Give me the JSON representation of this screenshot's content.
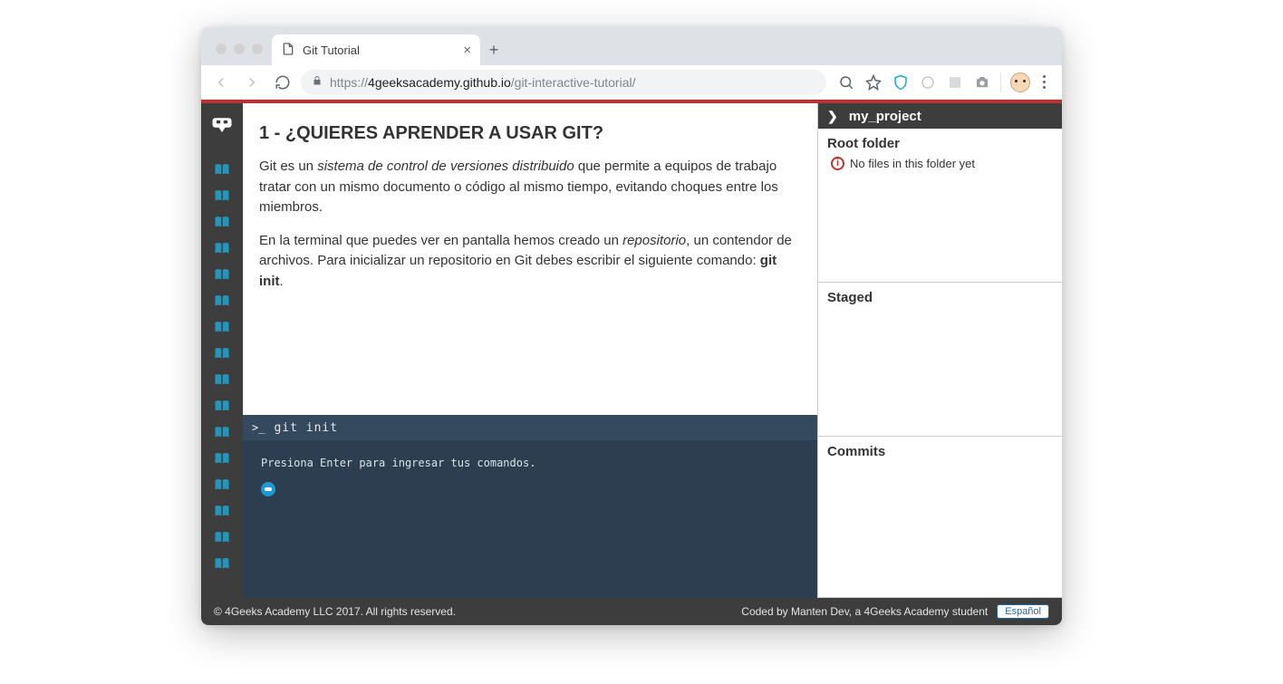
{
  "browser": {
    "tab_title": "Git Tutorial",
    "url_prefix": "https://",
    "url_host": "4geeksacademy.github.io",
    "url_path": "/git-interactive-tutorial/"
  },
  "sidebar": {
    "lesson_count": 16
  },
  "lesson": {
    "heading": "1 - ¿QUIERES APRENDER A USAR GIT?",
    "p1_a": "Git es un ",
    "p1_em": "sistema de control de versiones distribuido",
    "p1_b": " que permite a equipos de trabajo tratar con un mismo documento o código al mismo tiempo, evitando choques entre los miembros.",
    "p2_a": "En la terminal que puedes ver en pantalla hemos creado un ",
    "p2_em": "repositorio",
    "p2_b": ", un contendor de archivos. Para inicializar un repositorio en Git debes escribir el siguiente comando: ",
    "p2_strong": "git init",
    "p2_c": "."
  },
  "terminal": {
    "prompt": ">_",
    "command": "git init",
    "hint": "Presiona Enter para ingresar tus comandos."
  },
  "right": {
    "project_name": "my_project",
    "root_label": "Root folder",
    "root_empty": "No files in this folder yet",
    "staged_label": "Staged",
    "commits_label": "Commits"
  },
  "footer": {
    "copyright": "© 4Geeks Academy LLC 2017. All rights reserved.",
    "credit": "Coded by Manten Dev, a 4Geeks Academy student",
    "lang_button": "Español"
  }
}
